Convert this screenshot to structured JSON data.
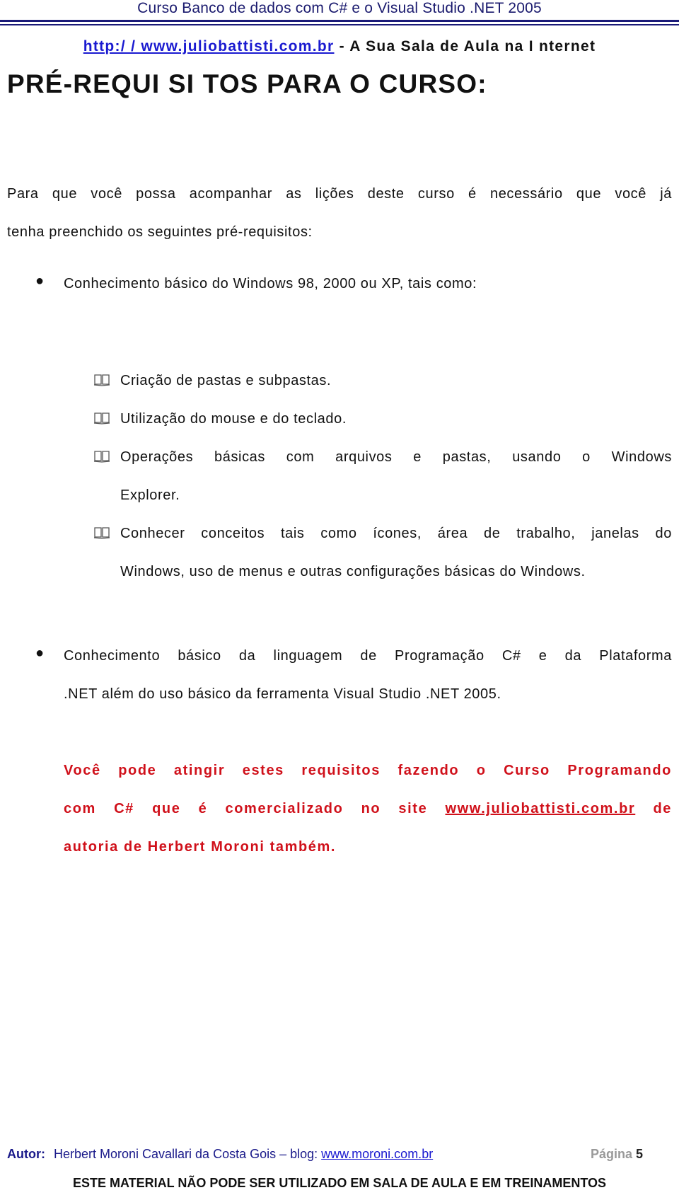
{
  "header": {
    "course_title": "Curso Banco de dados com C#  e o Visual Studio .NET 2005",
    "site_link": "http:/ / www.juliobattisti.com.br",
    "site_tagline": " - A Sua Sala de Aula na I nternet"
  },
  "main": {
    "title": "PRÉ-REQUI SI TOS PARA O CURSO:",
    "intro_line1": "Para que você possa acompanhar as lições deste curso é necessário que você já",
    "intro_line2": "tenha preenchido os seguintes pré-requisitos:",
    "bullets": [
      {
        "text": "Conhecimento básico do Windows 98, 2000 ou XP, tais como:",
        "sub_items": [
          {
            "icon": "book-icon",
            "text": "Criação de pastas e subpastas."
          },
          {
            "icon": "book-icon",
            "text": "Utilização do mouse e do teclado."
          },
          {
            "icon": "book-icon",
            "line1": "Operações básicas com arquivos e pastas, usando o Windows",
            "line2": "Explorer."
          },
          {
            "icon": "book-icon",
            "line1": "Conhecer conceitos tais como ícones, área de trabalho, janelas do",
            "line2": "Windows, uso de menus e outras configurações básicas do Windows."
          }
        ]
      },
      {
        "line1": "Conhecimento básico da linguagem de Programação C#  e da Plataforma",
        "line2": ".NET além do uso básico da ferramenta Visual Studio .NET 2005."
      }
    ],
    "note": {
      "line1": "Você pode atingir estes requisitos fazendo o Curso Programando",
      "line2_before": "com C#  que é comercializado no site ",
      "line2_link": "www.juliobattisti.com.br",
      "line2_after": " de",
      "line3": "autoria de Herbert Moroni também."
    }
  },
  "footer": {
    "author_label": "Autor:",
    "author_text": "Herbert Moroni Cavallari da Costa Gois – blog: ",
    "blog_link": "www.moroni.com.br",
    "page_label": "Página ",
    "page_number": "5",
    "warning": "ESTE MATERIAL NÃO PODE SER UTILIZADO EM SALA DE AULA E EM TREINAMENTOS"
  },
  "colors": {
    "header_blue": "#1a1a6e",
    "link_blue": "#1a1ad0",
    "note_red": "#d0101a"
  }
}
